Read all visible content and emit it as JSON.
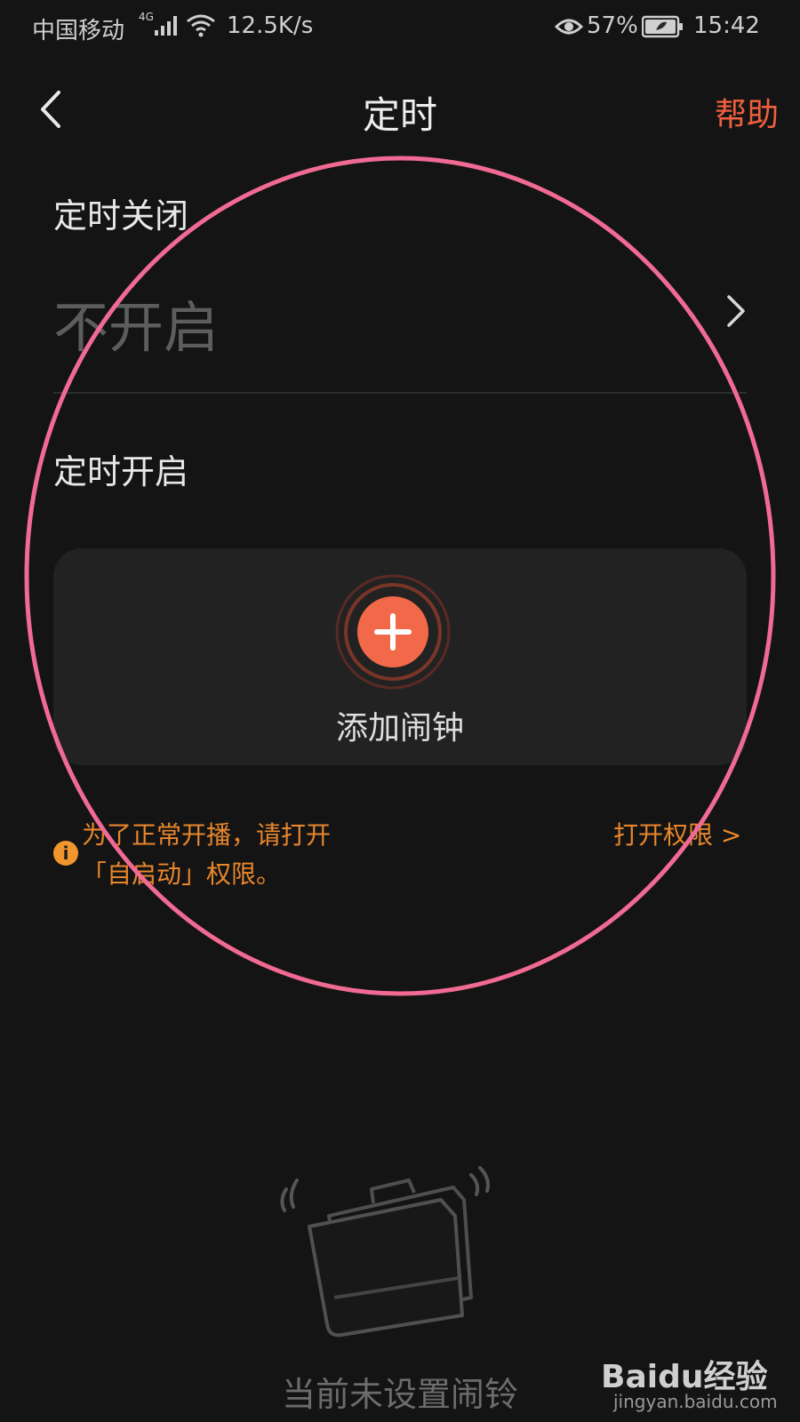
{
  "status_bar": {
    "carrier": "中国移动",
    "network_type": "4G",
    "speed": "12.5K/s",
    "battery": "57%",
    "time": "15:42"
  },
  "header": {
    "title": "定时",
    "help": "帮助"
  },
  "timer_off": {
    "label": "定时关闭",
    "value": "不开启"
  },
  "timer_on": {
    "label": "定时开启",
    "add_alarm": "添加闹钟"
  },
  "notice": {
    "line1": "为了正常开播，请打开",
    "line2": "「自启动」权限。",
    "link": "打开权限 >"
  },
  "empty_state": {
    "text": "当前未设置闹铃"
  },
  "watermark": {
    "brand": "Baidu经验",
    "url": "jingyan.baidu.com"
  },
  "colors": {
    "accent": "#f0603e",
    "warning": "#e8862b",
    "annotation": "#f06a94",
    "background": "#141414"
  }
}
